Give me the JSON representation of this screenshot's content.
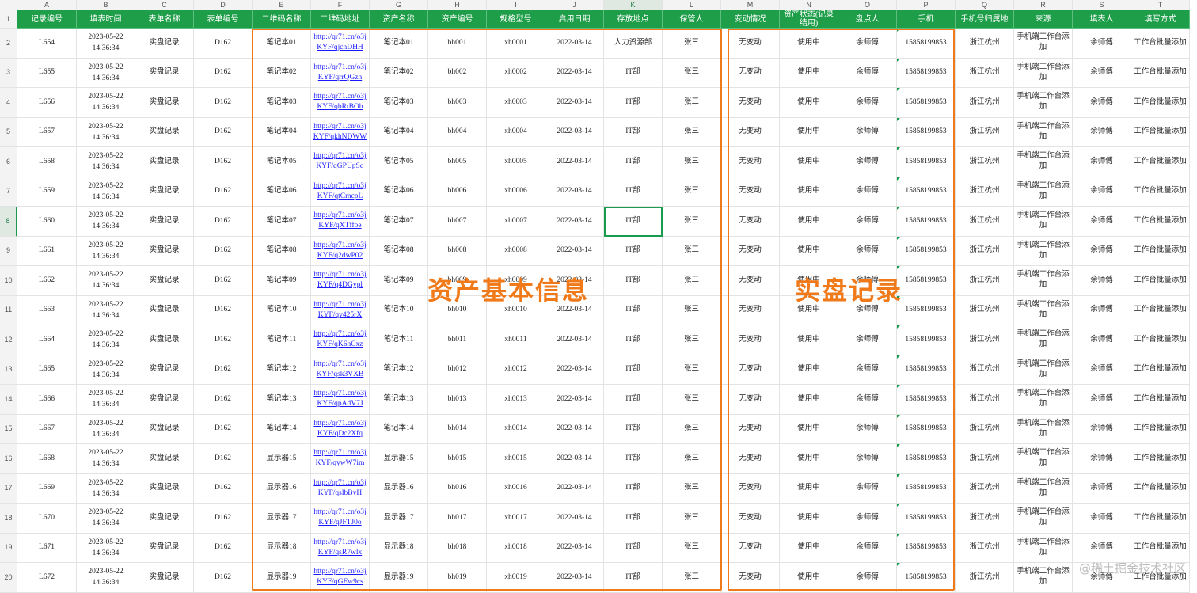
{
  "columns": [
    "A",
    "B",
    "C",
    "D",
    "E",
    "F",
    "G",
    "H",
    "I",
    "J",
    "K",
    "L",
    "M",
    "N",
    "O",
    "P",
    "Q",
    "R",
    "S",
    "T"
  ],
  "headers": [
    "记录编号",
    "填表时间",
    "表单名称",
    "表单编号",
    "二维码名称",
    "二维码地址",
    "资产名称",
    "资产编号",
    "规格型号",
    "启用日期",
    "存放地点",
    "保管人",
    "变动情况",
    "资产状态(记录结用)",
    "盘点人",
    "手机",
    "手机号归属地",
    "来源",
    "填表人",
    "填写方式"
  ],
  "rows": [
    {
      "n": "2",
      "cells": [
        "L654",
        "2023-05-22 14:36:34",
        "实盘记录",
        "D162",
        "笔记本01",
        "http://qr71.cn/o3jKYF/qjcnDHH",
        "笔记本01",
        "bh001",
        "xh0001",
        "2022-03-14",
        "人力资源部",
        "张三",
        "无变动",
        "使用中",
        "余师傅",
        "15858199853",
        "浙江杭州",
        "手机端工作台添加",
        "余师傅",
        "工作台批量添加"
      ]
    },
    {
      "n": "3",
      "cells": [
        "L655",
        "2023-05-22 14:36:34",
        "实盘记录",
        "D162",
        "笔记本02",
        "http://qr71.cn/o3jKYF/qrrQGzh",
        "笔记本02",
        "bh002",
        "xh0002",
        "2022-03-14",
        "IT部",
        "张三",
        "无变动",
        "使用中",
        "余师傅",
        "15858199853",
        "浙江杭州",
        "手机端工作台添加",
        "余师傅",
        "工作台批量添加"
      ]
    },
    {
      "n": "4",
      "cells": [
        "L656",
        "2023-05-22 14:36:34",
        "实盘记录",
        "D162",
        "笔记本03",
        "http://qr71.cn/o3jKYF/qbRtBOh",
        "笔记本03",
        "bh003",
        "xh0003",
        "2022-03-14",
        "IT部",
        "张三",
        "无变动",
        "使用中",
        "余师傅",
        "15858199853",
        "浙江杭州",
        "手机端工作台添加",
        "余师傅",
        "工作台批量添加"
      ]
    },
    {
      "n": "5",
      "cells": [
        "L657",
        "2023-05-22 14:36:34",
        "实盘记录",
        "D162",
        "笔记本04",
        "http://qr71.cn/o3jKYF/qkhNDWW",
        "笔记本04",
        "bh004",
        "xh0004",
        "2022-03-14",
        "IT部",
        "张三",
        "无变动",
        "使用中",
        "余师傅",
        "15858199853",
        "浙江杭州",
        "手机端工作台添加",
        "余师傅",
        "工作台批量添加"
      ]
    },
    {
      "n": "6",
      "cells": [
        "L658",
        "2023-05-22 14:36:34",
        "实盘记录",
        "D162",
        "笔记本05",
        "http://qr71.cn/o3jKYF/qGPUpSq",
        "笔记本05",
        "bh005",
        "xh0005",
        "2022-03-14",
        "IT部",
        "张三",
        "无变动",
        "使用中",
        "余师傅",
        "15858199853",
        "浙江杭州",
        "手机端工作台添加",
        "余师傅",
        "工作台批量添加"
      ]
    },
    {
      "n": "7",
      "cells": [
        "L659",
        "2023-05-22 14:36:34",
        "实盘记录",
        "D162",
        "笔记本06",
        "http://qr71.cn/o3jKYF/qtCmcpL",
        "笔记本06",
        "bh006",
        "xh0006",
        "2022-03-14",
        "IT部",
        "张三",
        "无变动",
        "使用中",
        "余师傅",
        "15858199853",
        "浙江杭州",
        "手机端工作台添加",
        "余师傅",
        "工作台批量添加"
      ]
    },
    {
      "n": "8",
      "cells": [
        "L660",
        "2023-05-22 14:36:34",
        "实盘记录",
        "D162",
        "笔记本07",
        "http://qr71.cn/o3jKYF/qXTffoe",
        "笔记本07",
        "bh007",
        "xh0007",
        "2022-03-14",
        "IT部",
        "张三",
        "无变动",
        "使用中",
        "余师傅",
        "15858199853",
        "浙江杭州",
        "手机端工作台添加",
        "余师傅",
        "工作台批量添加"
      ]
    },
    {
      "n": "9",
      "cells": [
        "L661",
        "2023-05-22 14:36:34",
        "实盘记录",
        "D162",
        "笔记本08",
        "http://qr71.cn/o3jKYF/q2dwP02",
        "笔记本08",
        "bh008",
        "xh0008",
        "2022-03-14",
        "IT部",
        "张三",
        "无变动",
        "使用中",
        "余师傅",
        "15858199853",
        "浙江杭州",
        "手机端工作台添加",
        "余师傅",
        "工作台批量添加"
      ]
    },
    {
      "n": "10",
      "cells": [
        "L662",
        "2023-05-22 14:36:34",
        "实盘记录",
        "D162",
        "笔记本09",
        "http://qr71.cn/o3jKYF/q4DGypl",
        "笔记本09",
        "bh009",
        "xh0009",
        "2022-03-14",
        "IT部",
        "张三",
        "无变动",
        "使用中",
        "余师傅",
        "15858199853",
        "浙江杭州",
        "手机端工作台添加",
        "余师傅",
        "工作台批量添加"
      ]
    },
    {
      "n": "11",
      "cells": [
        "L663",
        "2023-05-22 14:36:34",
        "实盘记录",
        "D162",
        "笔记本10",
        "http://qr71.cn/o3jKYF/qv425rX",
        "笔记本10",
        "bh010",
        "xh0010",
        "2022-03-14",
        "IT部",
        "张三",
        "无变动",
        "使用中",
        "余师傅",
        "15858199853",
        "浙江杭州",
        "手机端工作台添加",
        "余师傅",
        "工作台批量添加"
      ]
    },
    {
      "n": "12",
      "cells": [
        "L664",
        "2023-05-22 14:36:34",
        "实盘记录",
        "D162",
        "笔记本11",
        "http://qr71.cn/o3jKYF/qK6nCxz",
        "笔记本11",
        "bh011",
        "xh0011",
        "2022-03-14",
        "IT部",
        "张三",
        "无变动",
        "使用中",
        "余师傅",
        "15858199853",
        "浙江杭州",
        "手机端工作台添加",
        "余师傅",
        "工作台批量添加"
      ]
    },
    {
      "n": "13",
      "cells": [
        "L665",
        "2023-05-22 14:36:34",
        "实盘记录",
        "D162",
        "笔记本12",
        "http://qr71.cn/o3jKYF/qsk3VXB",
        "笔记本12",
        "bh012",
        "xh0012",
        "2022-03-14",
        "IT部",
        "张三",
        "无变动",
        "使用中",
        "余师傅",
        "15858199853",
        "浙江杭州",
        "手机端工作台添加",
        "余师傅",
        "工作台批量添加"
      ]
    },
    {
      "n": "14",
      "cells": [
        "L666",
        "2023-05-22 14:36:34",
        "实盘记录",
        "D162",
        "笔记本13",
        "http://qr71.cn/o3jKYF/qpAdV7J",
        "笔记本13",
        "bh013",
        "xh0013",
        "2022-03-14",
        "IT部",
        "张三",
        "无变动",
        "使用中",
        "余师傅",
        "15858199853",
        "浙江杭州",
        "手机端工作台添加",
        "余师傅",
        "工作台批量添加"
      ]
    },
    {
      "n": "15",
      "cells": [
        "L667",
        "2023-05-22 14:36:34",
        "实盘记录",
        "D162",
        "笔记本14",
        "http://qr71.cn/o3jKYF/qDc2Xfq",
        "笔记本14",
        "bh014",
        "xh0014",
        "2022-03-14",
        "IT部",
        "张三",
        "无变动",
        "使用中",
        "余师傅",
        "15858199853",
        "浙江杭州",
        "手机端工作台添加",
        "余师傅",
        "工作台批量添加"
      ]
    },
    {
      "n": "16",
      "cells": [
        "L668",
        "2023-05-22 14:36:34",
        "实盘记录",
        "D162",
        "显示器15",
        "http://qr71.cn/o3jKYF/qywW7im",
        "显示器15",
        "bh015",
        "xh0015",
        "2022-03-14",
        "IT部",
        "张三",
        "无变动",
        "使用中",
        "余师傅",
        "15858199853",
        "浙江杭州",
        "手机端工作台添加",
        "余师傅",
        "工作台批量添加"
      ]
    },
    {
      "n": "17",
      "cells": [
        "L669",
        "2023-05-22 14:36:34",
        "实盘记录",
        "D162",
        "显示器16",
        "http://qr71.cn/o3jKYF/qslbBvH",
        "显示器16",
        "bh016",
        "xh0016",
        "2022-03-14",
        "IT部",
        "张三",
        "无变动",
        "使用中",
        "余师傅",
        "15858199853",
        "浙江杭州",
        "手机端工作台添加",
        "余师傅",
        "工作台批量添加"
      ]
    },
    {
      "n": "18",
      "cells": [
        "L670",
        "2023-05-22 14:36:34",
        "实盘记录",
        "D162",
        "显示器17",
        "http://qr71.cn/o3jKYF/qJFTJ0o",
        "显示器17",
        "bh017",
        "xh0017",
        "2022-03-14",
        "IT部",
        "张三",
        "无变动",
        "使用中",
        "余师傅",
        "15858199853",
        "浙江杭州",
        "手机端工作台添加",
        "余师傅",
        "工作台批量添加"
      ]
    },
    {
      "n": "19",
      "cells": [
        "L671",
        "2023-05-22 14:36:34",
        "实盘记录",
        "D162",
        "显示器18",
        "http://qr71.cn/o3jKYF/qsR7wlx",
        "显示器18",
        "bh018",
        "xh0018",
        "2022-03-14",
        "IT部",
        "张三",
        "无变动",
        "使用中",
        "余师傅",
        "15858199853",
        "浙江杭州",
        "手机端工作台添加",
        "余师傅",
        "工作台批量添加"
      ]
    },
    {
      "n": "20",
      "cells": [
        "L672",
        "2023-05-22 14:36:34",
        "实盘记录",
        "D162",
        "显示器19",
        "http://qr71.cn/o3jKYF/qGEw9cs",
        "显示器19",
        "bh019",
        "xh0019",
        "2022-03-14",
        "IT部",
        "张三",
        "无变动",
        "使用中",
        "余师傅",
        "15858199853",
        "浙江杭州",
        "手机端工作台添加",
        "余师傅",
        "工作台批量添加"
      ]
    }
  ],
  "annotations": {
    "asset_info": "资产基本信息",
    "inventory_record": "实盘记录"
  },
  "watermark": "@稀土掘金技术社区",
  "colors": {
    "header_green": "#1f9e49",
    "highlight_orange": "#f07a1a",
    "link_blue": "#1a1aff"
  }
}
